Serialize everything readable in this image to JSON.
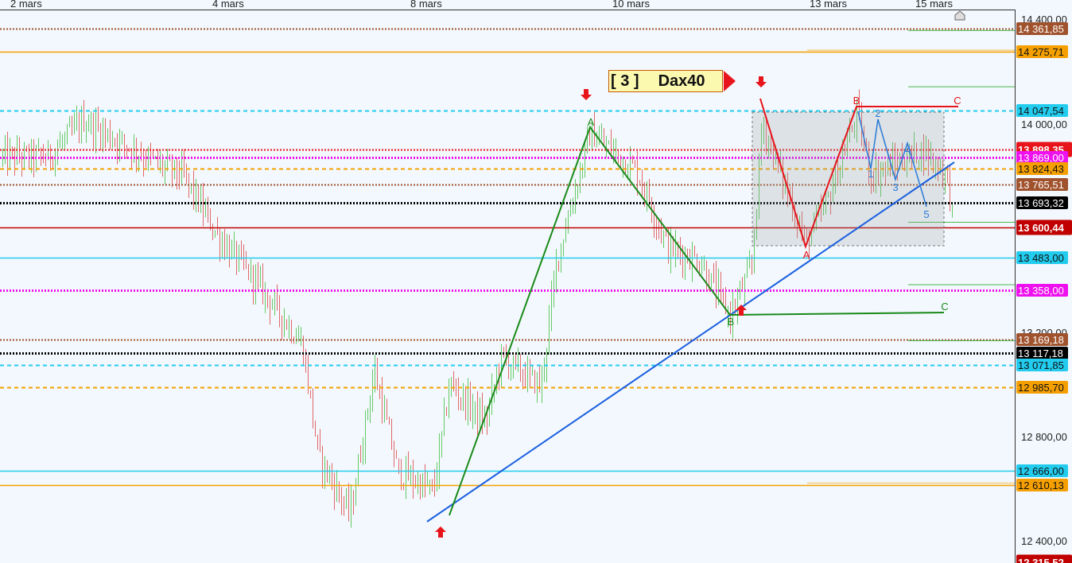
{
  "title": {
    "number": "[ 3 ]",
    "symbol": "Dax40"
  },
  "chart_data": {
    "type": "candlestick",
    "x_labels": [
      "2 mars",
      "4 mars",
      "8 mars",
      "10 mars",
      "13 mars",
      "15 mars"
    ],
    "y_axis_ticks": [
      "14 400,00",
      "14 000,00",
      "13 200,00",
      "12 800,00",
      "12 400,00"
    ],
    "y_range": [
      12315.52,
      14432
    ],
    "last_price": "13 600,44",
    "levels": [
      {
        "label": "14 361,85",
        "value": 14361.85,
        "color": "#a0522d",
        "style": "dotted",
        "tag_bg": "#a0522d",
        "tag_fg": "#ffffff"
      },
      {
        "label": "14 275,71",
        "value": 14275.71,
        "color": "#f5a000",
        "style": "solid",
        "tag_bg": "#f5a000",
        "tag_fg": "#111111"
      },
      {
        "label": "14 047,54",
        "value": 14047.54,
        "color": "#22ccee",
        "style": "dashed",
        "tag_bg": "#22ccee",
        "tag_fg": "#111111"
      },
      {
        "label": "13 898,35",
        "value": 13898.35,
        "color": "#e8141b",
        "style": "dotted",
        "tag_bg": "#e8141b",
        "tag_fg": "#ffffff"
      },
      {
        "label": "13 869,00",
        "value": 13869.0,
        "color": "#ee10ee",
        "style": "dotted",
        "tag_bg": "#ee10ee",
        "tag_fg": "#ffffff"
      },
      {
        "label": "13 824,43",
        "value": 13824.43,
        "color": "#f5a000",
        "style": "dashed",
        "tag_bg": "#f5a000",
        "tag_fg": "#111111"
      },
      {
        "label": "13 765,51",
        "value": 13765.51,
        "color": "#a0522d",
        "style": "dotted",
        "tag_bg": "#a0522d",
        "tag_fg": "#ffffff"
      },
      {
        "label": "13 693,32",
        "value": 13693.32,
        "color": "#000000",
        "style": "dotted",
        "tag_bg": "#000000",
        "tag_fg": "#ffffff"
      },
      {
        "label": "13 600,44",
        "value": 13600.44,
        "color": "#c00000",
        "style": "solid",
        "tag_bg": "#c00000",
        "tag_fg": "#ffffff"
      },
      {
        "label": "13 483,00",
        "value": 13483.0,
        "color": "#22ccee",
        "style": "solid",
        "tag_bg": "#22ccee",
        "tag_fg": "#111111"
      },
      {
        "label": "13 358,00",
        "value": 13358.0,
        "color": "#ee10ee",
        "style": "dotted",
        "tag_bg": "#ee10ee",
        "tag_fg": "#ffffff"
      },
      {
        "label": "13 169,18",
        "value": 13169.18,
        "color": "#a0522d",
        "style": "dotted",
        "tag_bg": "#a0522d",
        "tag_fg": "#ffffff"
      },
      {
        "label": "13 117,18",
        "value": 13117.18,
        "color": "#000000",
        "style": "dotted",
        "tag_bg": "#000000",
        "tag_fg": "#ffffff"
      },
      {
        "label": "13 071,85",
        "value": 13071.85,
        "color": "#22ccee",
        "style": "dashed",
        "tag_bg": "#22ccee",
        "tag_fg": "#111111"
      },
      {
        "label": "12 985,70",
        "value": 12985.7,
        "color": "#f5a000",
        "style": "dashed",
        "tag_bg": "#f5a000",
        "tag_fg": "#111111"
      },
      {
        "label": "12 666,00",
        "value": 12666.0,
        "color": "#22ccee",
        "style": "solid",
        "tag_bg": "#22ccee",
        "tag_fg": "#111111"
      },
      {
        "label": "12 610,13",
        "value": 12610.13,
        "color": "#f5a000",
        "style": "solid",
        "tag_bg": "#f5a000",
        "tag_fg": "#111111"
      },
      {
        "label": "12 315,52",
        "value": 12315.52,
        "color": "#c00000",
        "style": "none",
        "tag_bg": "#c00000",
        "tag_fg": "#ffffff"
      }
    ],
    "wave_green": {
      "labels": [
        "A",
        "B",
        "C"
      ],
      "points": [
        [
          12630,
          "start"
        ],
        [
          13963,
          "A"
        ],
        [
          13259,
          "B"
        ],
        [
          13265,
          "C"
        ]
      ]
    },
    "wave_red": {
      "labels": [
        "A",
        "B",
        "C"
      ],
      "points": [
        [
          14000,
          "start"
        ],
        [
          13540,
          "A"
        ],
        [
          14036,
          "B"
        ],
        [
          14036,
          "C"
        ]
      ]
    },
    "wave_blue": {
      "labels": [
        "1",
        "2",
        "3",
        "4",
        "5"
      ]
    },
    "trendline_color": "#1a5fe0",
    "up_candle_color": "#4cc24c",
    "down_candle_color": "#e05050"
  }
}
